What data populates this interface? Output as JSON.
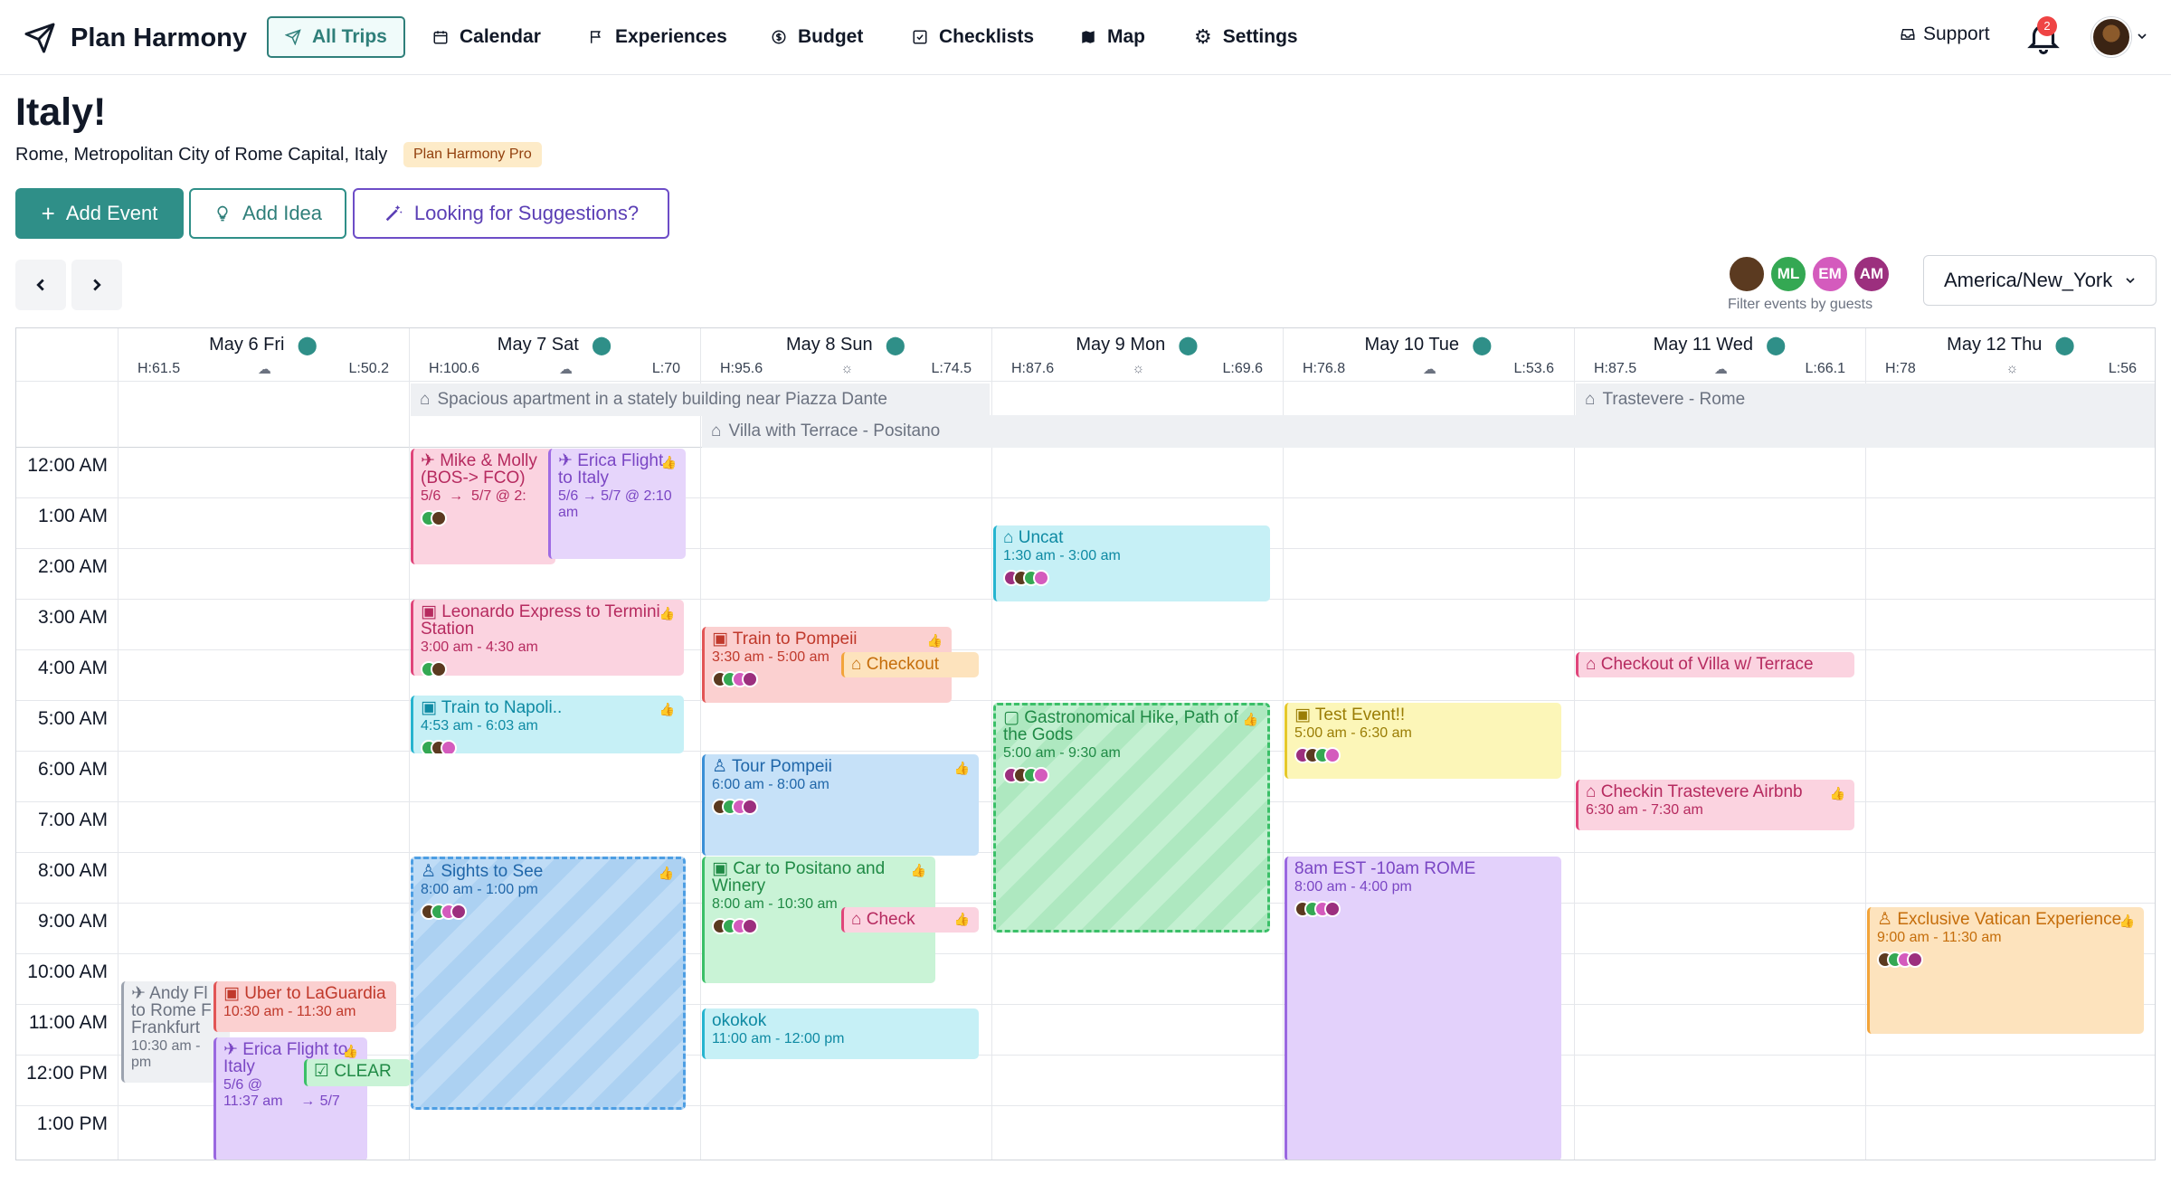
{
  "app": {
    "name": "Plan Harmony",
    "nav": [
      {
        "label": "All Trips",
        "icon": "paper-plane-icon",
        "active": true
      },
      {
        "label": "Calendar",
        "icon": "calendar-icon"
      },
      {
        "label": "Experiences",
        "icon": "flag-icon"
      },
      {
        "label": "Budget",
        "icon": "dollar-circle-icon"
      },
      {
        "label": "Checklists",
        "icon": "checkbox-icon"
      },
      {
        "label": "Map",
        "icon": "map-icon"
      },
      {
        "label": "Settings",
        "icon": "gear-icon"
      }
    ],
    "support_label": "Support",
    "notification_count": "2"
  },
  "trip": {
    "title": "Italy!",
    "location": "Rome, Metropolitan City of Rome Capital, Italy",
    "badge": "Plan Harmony Pro"
  },
  "actions": {
    "add_event": "Add Event",
    "add_idea": "Add Idea",
    "suggestions": "Looking for Suggestions?"
  },
  "guests": {
    "list": [
      {
        "initials": "",
        "color": "#5b3a20"
      },
      {
        "initials": "ML",
        "color": "#34a853"
      },
      {
        "initials": "EM",
        "color": "#d45bbd"
      },
      {
        "initials": "AM",
        "color": "#9c2f7e"
      }
    ],
    "filter_label": "Filter events by guests"
  },
  "timezone": "America/New_York",
  "days": [
    {
      "label": "May 6 Fri",
      "high": "H:61.5",
      "low": "L:50.2"
    },
    {
      "label": "May 7 Sat",
      "high": "H:100.6",
      "low": "L:70"
    },
    {
      "label": "May 8 Sun",
      "high": "H:95.6",
      "low": "L:74.5"
    },
    {
      "label": "May 9 Mon",
      "high": "H:87.6",
      "low": "L:69.6"
    },
    {
      "label": "May 10 Tue",
      "high": "H:76.8",
      "low": "L:53.6"
    },
    {
      "label": "May 11 Wed",
      "high": "H:87.5",
      "low": "L:66.1"
    },
    {
      "label": "May 12 Thu",
      "high": "H:78",
      "low": "L:56"
    }
  ],
  "stays": [
    {
      "label": "Spacious apartment in a stately building near Piazza Dante"
    },
    {
      "label": "Villa with Terrace - Positano"
    },
    {
      "label": "Trastevere - Rome"
    }
  ],
  "hours": [
    "12:00 AM",
    "1:00 AM",
    "2:00 AM",
    "3:00 AM",
    "4:00 AM",
    "5:00 AM",
    "6:00 AM",
    "7:00 AM",
    "8:00 AM",
    "9:00 AM",
    "10:00 AM",
    "11:00 AM",
    "12:00 PM",
    "1:00 PM"
  ],
  "events": {
    "mike_molly": {
      "title": "Mike & Molly (BOS-> FCO)",
      "from": "5/6",
      "to": "5/7 @ 2:"
    },
    "erica_flight_1": {
      "title": "Erica Flight to Italy",
      "from": "5/6",
      "to": "5/7 @ 2:10 am"
    },
    "leonardo": {
      "title": "Leonardo Express to Termini Station",
      "time": "3:00 am - 4:30 am"
    },
    "train_napoli": {
      "title": "Train to Napoli..",
      "time": "4:53 am - 6:03 am"
    },
    "sights": {
      "title": "Sights to See",
      "time": "8:00 am - 1:00 pm"
    },
    "train_pompeii": {
      "title": "Train to Pompeii",
      "time": "3:30 am - 5:00 am"
    },
    "checkout_1": {
      "title": "Checkout"
    },
    "tour_pompeii": {
      "title": "Tour Pompeii",
      "time": "6:00 am - 8:00 am"
    },
    "car_positano": {
      "title": "Car to Positano and Winery",
      "time": "8:00 am - 10:30 am"
    },
    "check": {
      "title": "Check"
    },
    "okokok": {
      "title": "okokok",
      "time": "11:00 am - 12:00 pm"
    },
    "uncat": {
      "title": "Uncat",
      "time": "1:30 am - 3:00 am"
    },
    "hike": {
      "title": "Gastronomical Hike, Path of the Gods",
      "time": "5:00 am - 9:30 am"
    },
    "test_event": {
      "title": "Test Event!!",
      "time": "5:00 am - 6:30 am"
    },
    "rome_time": {
      "title": "8am EST -10am ROME",
      "time": "8:00 am - 4:00 pm"
    },
    "checkout_villa": {
      "title": "Checkout of Villa w/ Terrace"
    },
    "checkin_trastevere": {
      "title": "Checkin Trastevere Airbnb",
      "time": "6:30 am - 7:30 am"
    },
    "vatican": {
      "title": "Exclusive Vatican Experience",
      "time": "9:00 am - 11:30 am"
    },
    "andy": {
      "title": "Andy Fl to Rome F Frankfurt",
      "time": "10:30 am - pm"
    },
    "uber": {
      "title": "Uber to LaGuardia",
      "time": "10:30 am - 11:30 am"
    },
    "erica_flight_2": {
      "title": "Erica Flight to Italy",
      "from": "5/6 @ 11:37 am",
      "to": "5/7"
    },
    "clear": {
      "title": "CLEAR"
    }
  }
}
